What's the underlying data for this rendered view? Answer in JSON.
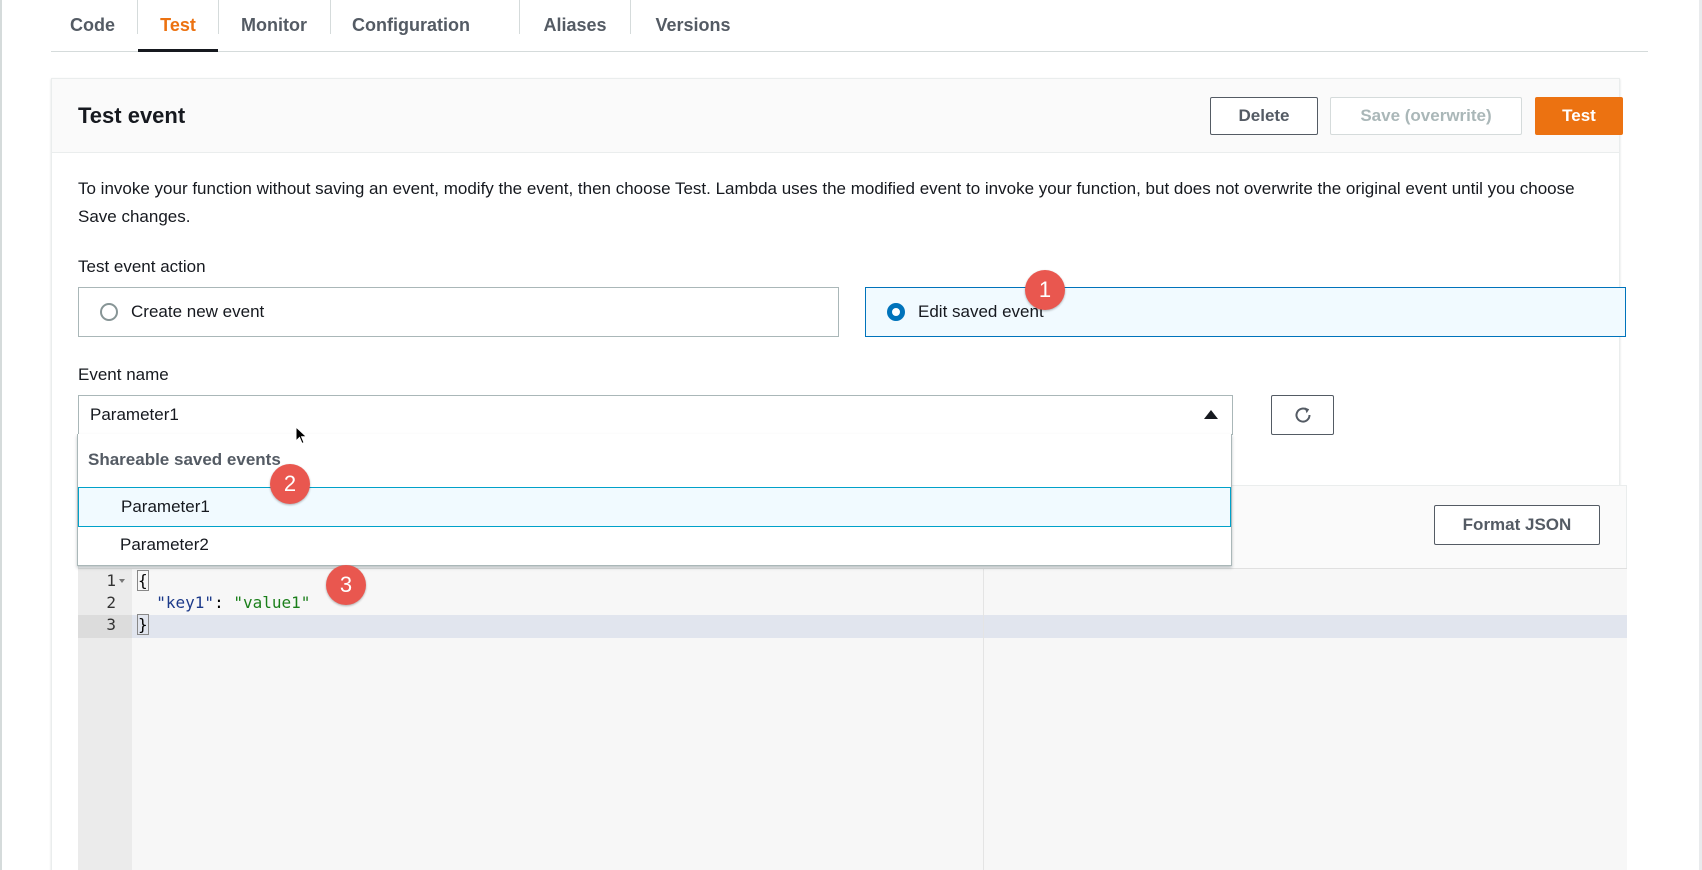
{
  "tabs": [
    {
      "label": "Code",
      "active": false
    },
    {
      "label": "Test",
      "active": true
    },
    {
      "label": "Monitor",
      "active": false
    },
    {
      "label": "Configuration",
      "active": false
    },
    {
      "label": "Aliases",
      "active": false
    },
    {
      "label": "Versions",
      "active": false
    }
  ],
  "panel": {
    "title": "Test event",
    "buttons": {
      "delete": "Delete",
      "save": "Save (overwrite)",
      "test": "Test"
    },
    "description": "To invoke your function without saving an event, modify the event, then choose Test. Lambda uses the modified event to invoke your function, but does not overwrite the original event until you choose Save changes."
  },
  "test_event_action": {
    "label": "Test event action",
    "options": [
      {
        "label": "Create new event",
        "selected": false
      },
      {
        "label": "Edit saved event",
        "selected": true
      }
    ]
  },
  "event_name": {
    "label": "Event name",
    "value": "Parameter1",
    "dropdown": {
      "group_label": "Shareable saved events",
      "items": [
        "Parameter1",
        "Parameter2"
      ],
      "highlighted": "Parameter1"
    }
  },
  "editor": {
    "format_button": "Format JSON",
    "line_numbers": [
      "1",
      "2",
      "3"
    ],
    "lines": {
      "open": "{",
      "key": "\"key1\"",
      "colon": ": ",
      "value": "\"value1\"",
      "close": "}"
    }
  },
  "badges": [
    "1",
    "2",
    "3"
  ],
  "colors": {
    "accent_orange": "#ec7211",
    "selected_blue": "#0073bb",
    "badge_red": "#e9574f"
  }
}
